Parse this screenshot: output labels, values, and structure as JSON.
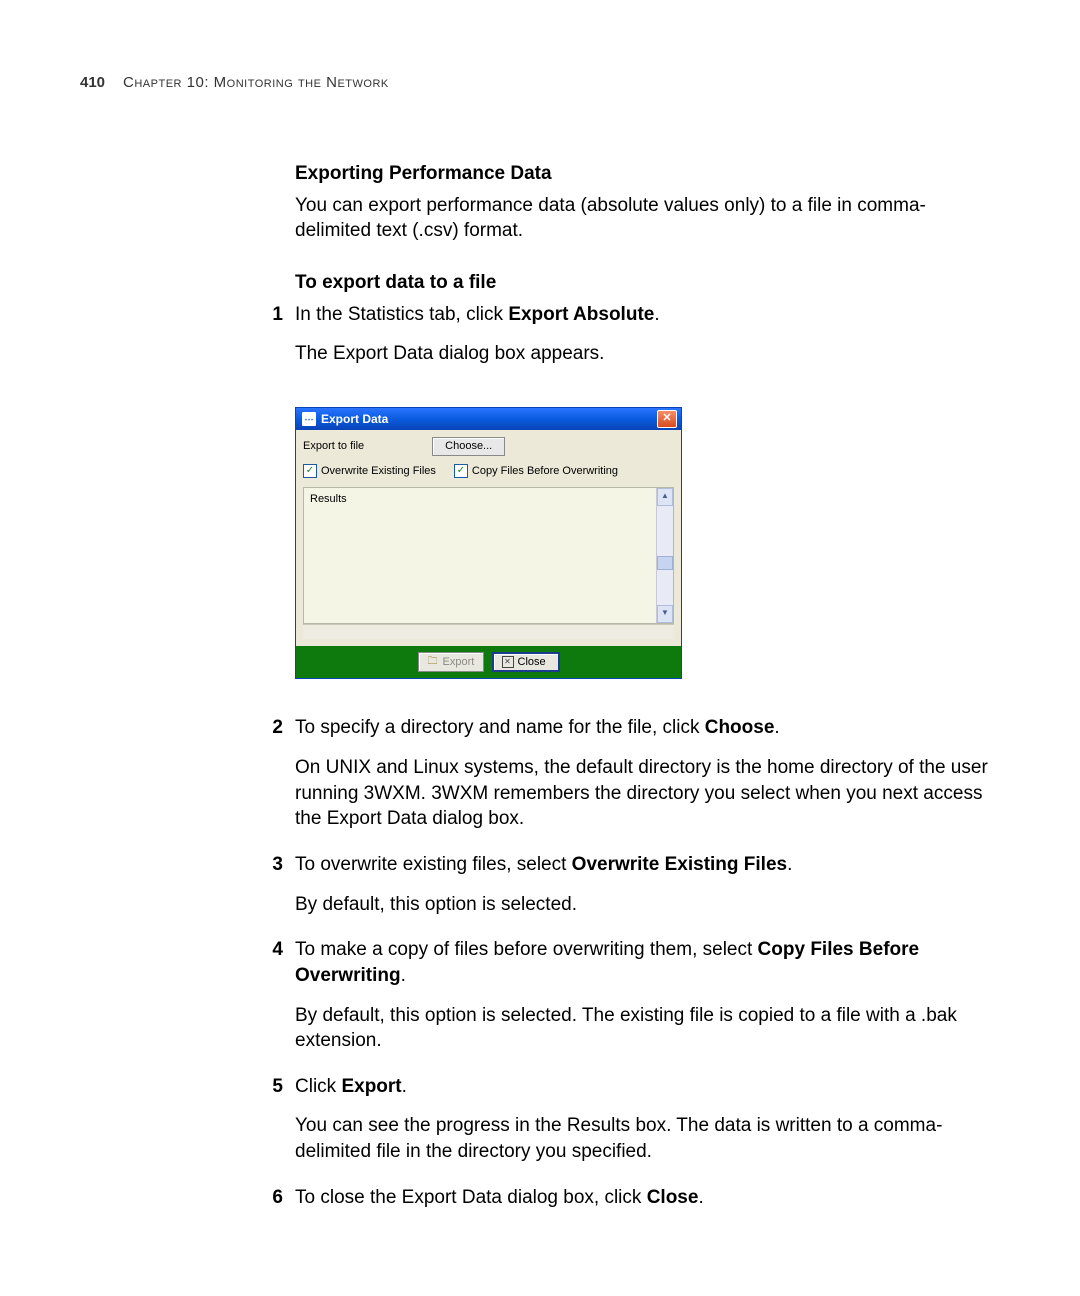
{
  "page": {
    "number": "410",
    "chapter": "Chapter 10: Monitoring the Network"
  },
  "section": {
    "heading": "Exporting Performance Data",
    "intro": "You can export performance data (absolute values only) to a file in comma-delimited text (.csv) format.",
    "sub_heading": "To export data to a file"
  },
  "steps": {
    "s1": {
      "num": "1",
      "text_a": "In the Statistics tab, click ",
      "text_b": "Export Absolute",
      "text_c": ".",
      "para2": "The Export Data dialog box appears."
    },
    "s2": {
      "num": "2",
      "text_a": "To specify a directory and name for the file, click ",
      "text_b": "Choose",
      "text_c": ".",
      "para2": "On UNIX and Linux systems, the default directory is the home directory of the user running 3WXM. 3WXM remembers the directory you select when you next access the Export Data dialog box."
    },
    "s3": {
      "num": "3",
      "text_a": "To overwrite existing files, select ",
      "text_b": "Overwrite Existing Files",
      "text_c": ".",
      "para2": "By default, this option is selected."
    },
    "s4": {
      "num": "4",
      "text_a": "To make a copy of files before overwriting them, select ",
      "text_b": "Copy Files Before Overwriting",
      "text_c": ".",
      "para2": "By default, this option is selected. The existing file is copied to a file with a .bak extension."
    },
    "s5": {
      "num": "5",
      "text_a": "Click ",
      "text_b": "Export",
      "text_c": ".",
      "para2": "You can see the progress in the Results box. The data is written to a comma-delimited file in the directory you specified."
    },
    "s6": {
      "num": "6",
      "text_a": "To close the Export Data dialog box, click ",
      "text_b": "Close",
      "text_c": "."
    }
  },
  "dialog": {
    "title": "Export Data",
    "export_to_file": "Export to file",
    "choose": "Choose...",
    "overwrite": "Overwrite Existing Files",
    "copy_before": "Copy Files Before Overwriting",
    "results": "Results",
    "export_btn": "Export",
    "close_btn": "Close"
  }
}
